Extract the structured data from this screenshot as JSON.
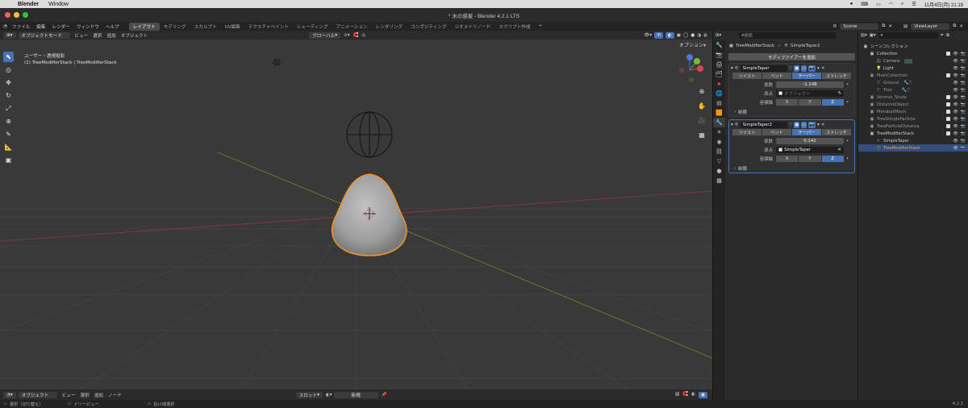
{
  "mac": {
    "app": "Blender",
    "menu_window": "Window",
    "datetime": "11月4日(月) 21:19"
  },
  "window_title": "* 水の惑星 - Blender 4.2.1 LTS",
  "topbar": {
    "menus": [
      "ファイル",
      "編集",
      "レンダー",
      "ウィンドウ",
      "ヘルプ"
    ],
    "workspaces": [
      "レイアウト",
      "モデリング",
      "スカルプト",
      "UV編集",
      "テクスチャペイント",
      "シェーディング",
      "アニメーション",
      "レンダリング",
      "コンポジティング",
      "ジオメトリノード",
      "スクリプト作成"
    ],
    "active_workspace": "レイアウト",
    "add_tab": "+",
    "scene": "Scene",
    "view_layer": "ViewLayer"
  },
  "header3d": {
    "mode": "オブジェクトモード",
    "menus": [
      "ビュー",
      "選択",
      "追加",
      "オブジェクト"
    ],
    "orientation": "グローバル",
    "options": "オプション"
  },
  "viewport": {
    "info_line1": "ユーザー・透視投影",
    "info_line2": "(1) TreeModifierStack | TreeModifierStack",
    "gizmo": {
      "x": "X",
      "y": "Y",
      "z": "Z"
    }
  },
  "bottom": {
    "mode": "オブジェクト",
    "menus": [
      "ビュー",
      "選択",
      "追加",
      "ノード"
    ],
    "slot": "スロット",
    "new": "新規"
  },
  "status": {
    "select": "選択（切り替え）",
    "pan": "ドリーピュー",
    "lasso": "投げ縄選択",
    "version": "4.2.1"
  },
  "properties": {
    "search_placeholder": "検索",
    "breadcrumb_obj": "TreeModifierStack",
    "breadcrumb_mod": "SimpleTaper2",
    "add_modifier": "モディファイアーを追加",
    "modifiers": [
      {
        "name": "SimpleTaper",
        "modes": [
          "ツイスト",
          "ベンド",
          "テーパー",
          "ストレッチ"
        ],
        "active_mode": "テーパー",
        "factor_label": "係数",
        "factor": "-1.148",
        "origin_label": "原点",
        "origin": "オブジェクト",
        "axis_label": "座標軸",
        "axes": [
          "X",
          "Y",
          "Z"
        ],
        "active_axis": "Z",
        "limits": "制限"
      },
      {
        "name": "SimpleTaper2",
        "modes": [
          "ツイスト",
          "ベンド",
          "テーパー",
          "ストレッチ"
        ],
        "active_mode": "テーパー",
        "factor_label": "係数",
        "factor": "0.142",
        "origin_label": "原点",
        "origin": "SimpleTaper",
        "axis_label": "座標軸",
        "axes": [
          "X",
          "Y",
          "Z"
        ],
        "active_axis": "Z",
        "limits": "制限"
      }
    ]
  },
  "outliner": {
    "search_placeholder": "",
    "root": "シーンコレクション",
    "items": [
      {
        "name": "Collection",
        "indent": 1
      },
      {
        "name": "Camera",
        "indent": 2
      },
      {
        "name": "Light",
        "indent": 2
      },
      {
        "name": "MainCollection",
        "indent": 1
      },
      {
        "name": "Ground",
        "indent": 2
      },
      {
        "name": "Tree",
        "indent": 2
      },
      {
        "name": "Voronoi_Study",
        "indent": 1
      },
      {
        "name": "DistanceObject",
        "indent": 1
      },
      {
        "name": "MetaballMesh",
        "indent": 1
      },
      {
        "name": "TreeSimpleParticle",
        "indent": 1
      },
      {
        "name": "TreeParticleDistance",
        "indent": 1
      },
      {
        "name": "TreeModifierStack",
        "indent": 1
      },
      {
        "name": "SimpleTaper",
        "indent": 2
      },
      {
        "name": "TreeModifierStack",
        "indent": 2
      }
    ]
  }
}
